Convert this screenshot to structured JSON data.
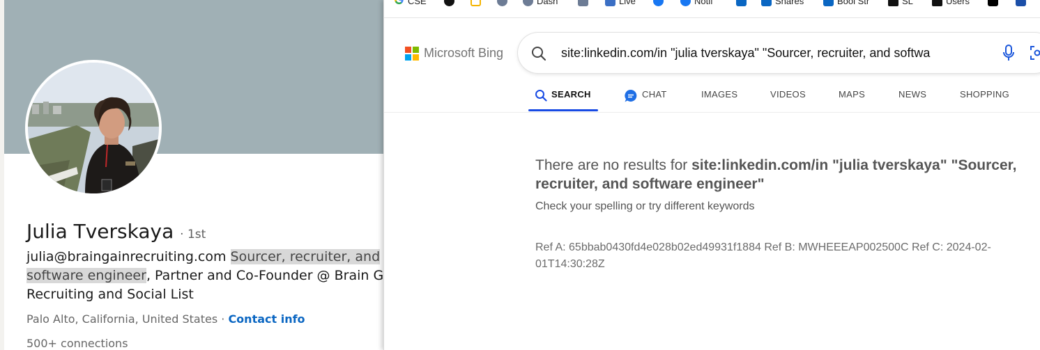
{
  "profile": {
    "name": "Julia Tverskaya",
    "degree": "· 1st",
    "headline_email": "julia@braingainrecruiting.com",
    "headline_highlight_1": "Sourcer, recruiter, and",
    "headline_highlight_2": "software engineer",
    "headline_rest_1": ", Partner and Co-Founder @ Brain G",
    "headline_rest_2": "Recruiting and Social List",
    "location": "Palo Alto, California, United States",
    "location_separator": " · ",
    "contact_info": "Contact info",
    "connections": "500+ connections",
    "colors": {
      "banner": "#a0b0b5",
      "link": "#0a66c2"
    }
  },
  "bookmarks": [
    {
      "label": "CSE",
      "icon": "google-icon"
    },
    {
      "label": "",
      "icon": "globe-icon"
    },
    {
      "label": "",
      "icon": "app-icon"
    },
    {
      "label": "",
      "icon": "search-glass-icon"
    },
    {
      "label": "Dash",
      "icon": "dash-icon"
    },
    {
      "label": "",
      "icon": "image-search-icon"
    },
    {
      "label": "Live",
      "icon": "live-icon"
    },
    {
      "label": "",
      "icon": "facebook-icon"
    },
    {
      "label": "Notif",
      "icon": "facebook-icon"
    },
    {
      "label": "",
      "icon": "linkedin-icon"
    },
    {
      "label": "Shares",
      "icon": "linkedin-icon"
    },
    {
      "label": "Bool Str",
      "icon": "linkedin-icon"
    },
    {
      "label": "SL",
      "icon": "user-icon"
    },
    {
      "label": "Users",
      "icon": "user-icon"
    },
    {
      "label": "",
      "icon": "x-icon"
    },
    {
      "label": "",
      "icon": "paypal-icon"
    }
  ],
  "bing": {
    "logo_text": "Microsoft Bing",
    "query": "site:linkedin.com/in \"julia tverskaya\" \"Sourcer, recruiter, and softwa",
    "tabs": [
      "SEARCH",
      "CHAT",
      "IMAGES",
      "VIDEOS",
      "MAPS",
      "NEWS",
      "SHOPPING"
    ],
    "active_tab": "SEARCH",
    "no_results_prefix": "There are no results for ",
    "no_results_query": "site:linkedin.com/in \"julia tverskaya\" \"Sourcer, recruiter, and software engineer\"",
    "hint": "Check your spelling or try different keywords",
    "ref_line": "Ref A: 65bbab0430fd4e028b02ed49931f1884 Ref B: MWHEEEAP002500C Ref C: 2024-02-01T14:30:28Z",
    "colors": {
      "accent": "#174ae4"
    }
  }
}
